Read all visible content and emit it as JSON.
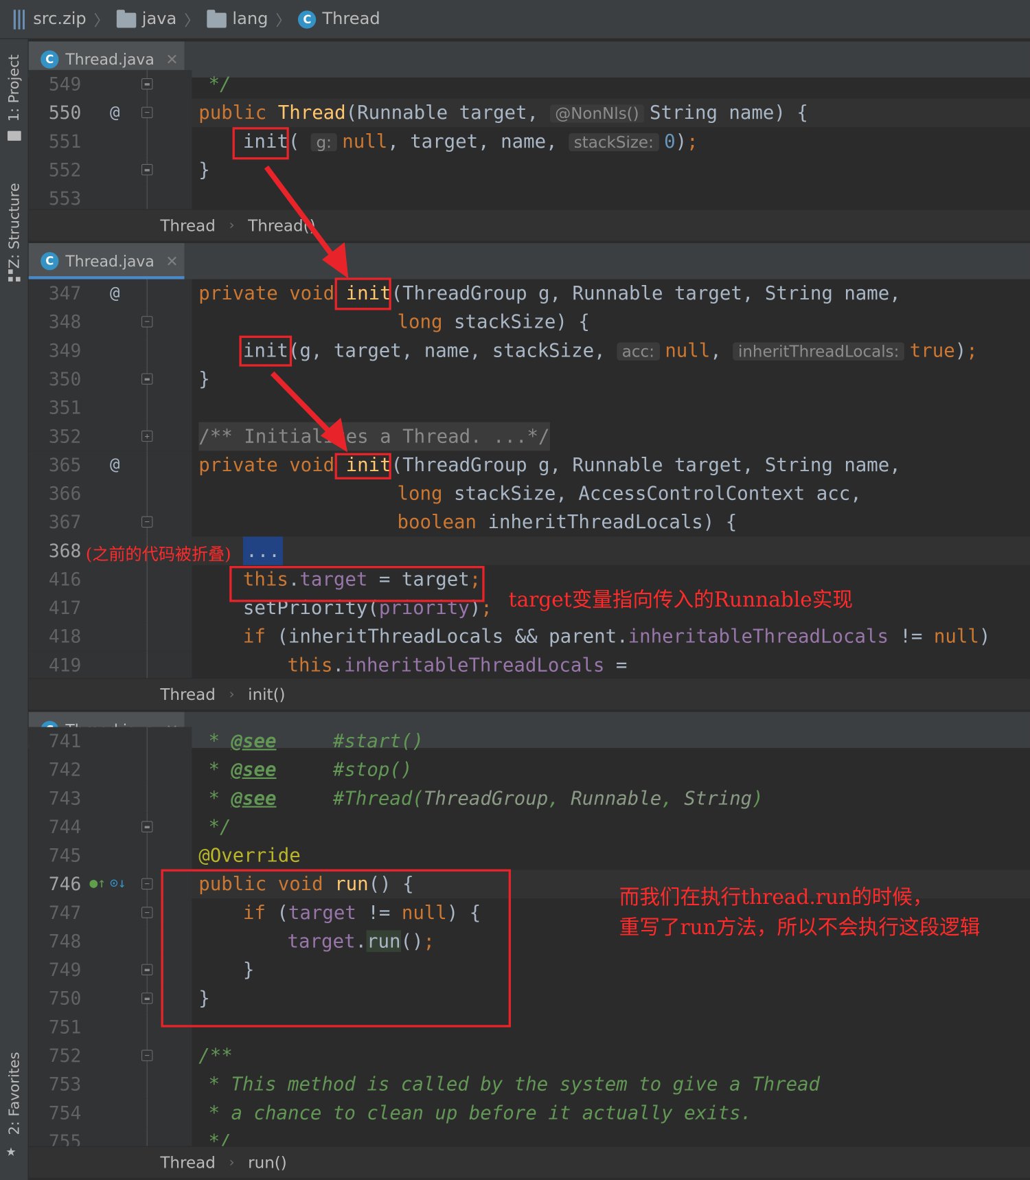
{
  "breadcrumb": {
    "archive": "src.zip",
    "pkg1": "java",
    "pkg2": "lang",
    "cls": "Thread",
    "cls_icon": "C"
  },
  "tool_windows": {
    "project": "1: Project",
    "structure": "Z: Structure",
    "favorites": "2: Favorites"
  },
  "tab_label": "Thread.java",
  "panels": [
    {
      "crumb": [
        "Thread",
        "Thread()"
      ],
      "line_numbers": [
        "549",
        "550",
        "551",
        "552",
        "553"
      ]
    },
    {
      "crumb": [
        "Thread",
        "init()"
      ],
      "line_numbers": [
        "347",
        "348",
        "349",
        "350",
        "351",
        "352",
        "365",
        "366",
        "367",
        "368",
        "416",
        "417",
        "418",
        "419"
      ]
    },
    {
      "crumb": [
        "Thread",
        "run()"
      ],
      "line_numbers": [
        "741",
        "742",
        "743",
        "744",
        "745",
        "746",
        "747",
        "748",
        "749",
        "750",
        "751",
        "752",
        "753",
        "754",
        "755"
      ]
    }
  ],
  "hints": {
    "nonnls": "@NonNls()",
    "g": "g:",
    "stacksize": "stackSize:",
    "acc": "acc:",
    "inherit": "inheritThreadLocals:"
  },
  "folded_comment": "/** Initializes a Thread. ...*/",
  "folded_marker": "...",
  "annotations": {
    "folded": "(之前的代码被折叠)",
    "target": "target变量指向传入的Runnable实现",
    "run_line1": "而我们在执行thread.run的时候，",
    "run_line2": "重写了run方法，所以不会执行这段逻辑"
  },
  "colors": {
    "keyword": "#cc7832",
    "method": "#ffc66d",
    "field": "#9876aa",
    "number": "#6897bb",
    "doc": "#629755",
    "annotation": "#bbb529",
    "callout": "#e8242a"
  }
}
